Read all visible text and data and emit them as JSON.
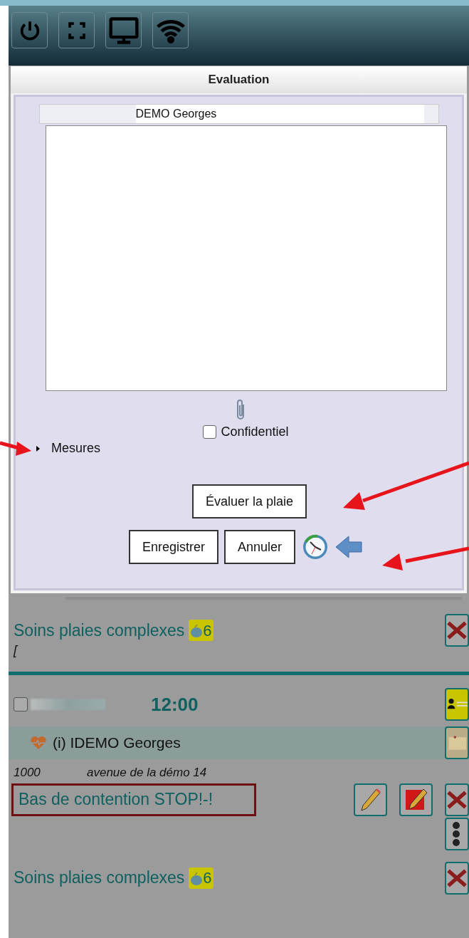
{
  "toolbar": {
    "buttons": [
      {
        "kind": "power"
      },
      {
        "kind": "fullscreen"
      },
      {
        "kind": "monitor"
      },
      {
        "kind": "wifi"
      }
    ]
  },
  "dialog": {
    "title": "Evaluation",
    "patient": "DEMO Georges",
    "confidential": {
      "label": "Confidentiel",
      "checked": false
    },
    "section": {
      "label": "Mesures",
      "expanded": false
    },
    "evaluate_button": "Évaluer la plaie",
    "buttons": [
      "Enregistrer",
      "Annuler"
    ]
  },
  "background": {
    "first_entry": {
      "title": "Soins plaies complexes",
      "badge": "6",
      "note": "["
    },
    "visit": {
      "checked": false,
      "time": "12:00",
      "patient": "(i) IDEMO Georges",
      "postcode": "1000",
      "address": "avenue de la démo 14",
      "alert": "Bas de contention STOP!-!",
      "entry": {
        "title": "Soins plaies complexes",
        "badge": "6"
      }
    }
  }
}
